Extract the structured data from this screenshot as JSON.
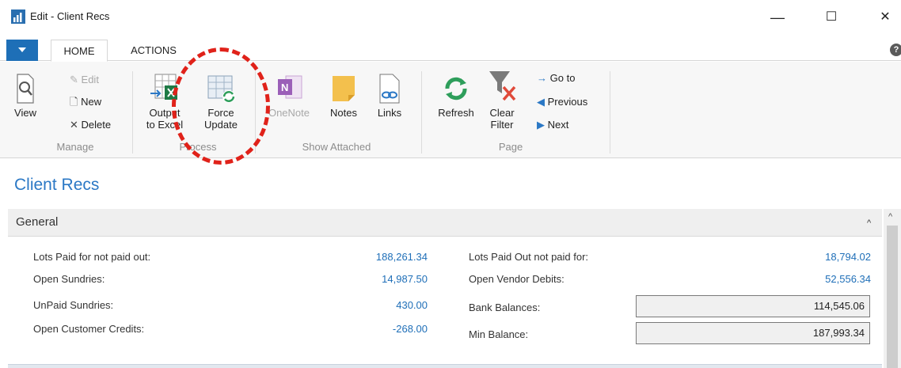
{
  "window": {
    "title": "Edit - Client Recs",
    "minimize": "—",
    "maximize": "☐",
    "close": "✕"
  },
  "tabs": [
    {
      "label": "HOME",
      "active": true
    },
    {
      "label": "ACTIONS",
      "active": false
    }
  ],
  "help_glyph": "?",
  "ribbon": {
    "manage": {
      "view": "View",
      "edit": "Edit",
      "new": "New",
      "delete": "Delete",
      "group": "Manage"
    },
    "process": {
      "output_l1": "Output",
      "output_l2": "to Excel",
      "force_l1": "Force",
      "force_l2": "Update",
      "group": "Process"
    },
    "attached": {
      "onenote": "OneNote",
      "notes": "Notes",
      "links": "Links",
      "group": "Show Attached"
    },
    "page": {
      "refresh": "Refresh",
      "clear_l1": "Clear",
      "clear_l2": "Filter",
      "goto": "Go to",
      "previous": "Previous",
      "next": "Next",
      "group": "Page"
    }
  },
  "page_title": "Client Recs",
  "fasttab": {
    "title": "General",
    "chevron": "^"
  },
  "fields_left": [
    {
      "label": "Lots Paid for not paid out:",
      "value": "188,261.34"
    },
    {
      "label": "Open Sundries:",
      "value": "14,987.50"
    },
    {
      "label": "UnPaid Sundries:",
      "value": "430.00"
    },
    {
      "label": "Open Customer Credits:",
      "value": "-268.00"
    }
  ],
  "fields_right": [
    {
      "label": "Lots Paid Out not paid for:",
      "value": "18,794.02"
    },
    {
      "label": "Open Vendor Debits:",
      "value": "52,556.34"
    },
    {
      "label": "Bank Balances:",
      "value": "114,545.06"
    },
    {
      "label": "Min Balance:",
      "value": "187,993.34"
    }
  ],
  "colors": {
    "accent": "#1e6fb7",
    "link": "#1f6fb8",
    "annotation": "#e0221a"
  }
}
